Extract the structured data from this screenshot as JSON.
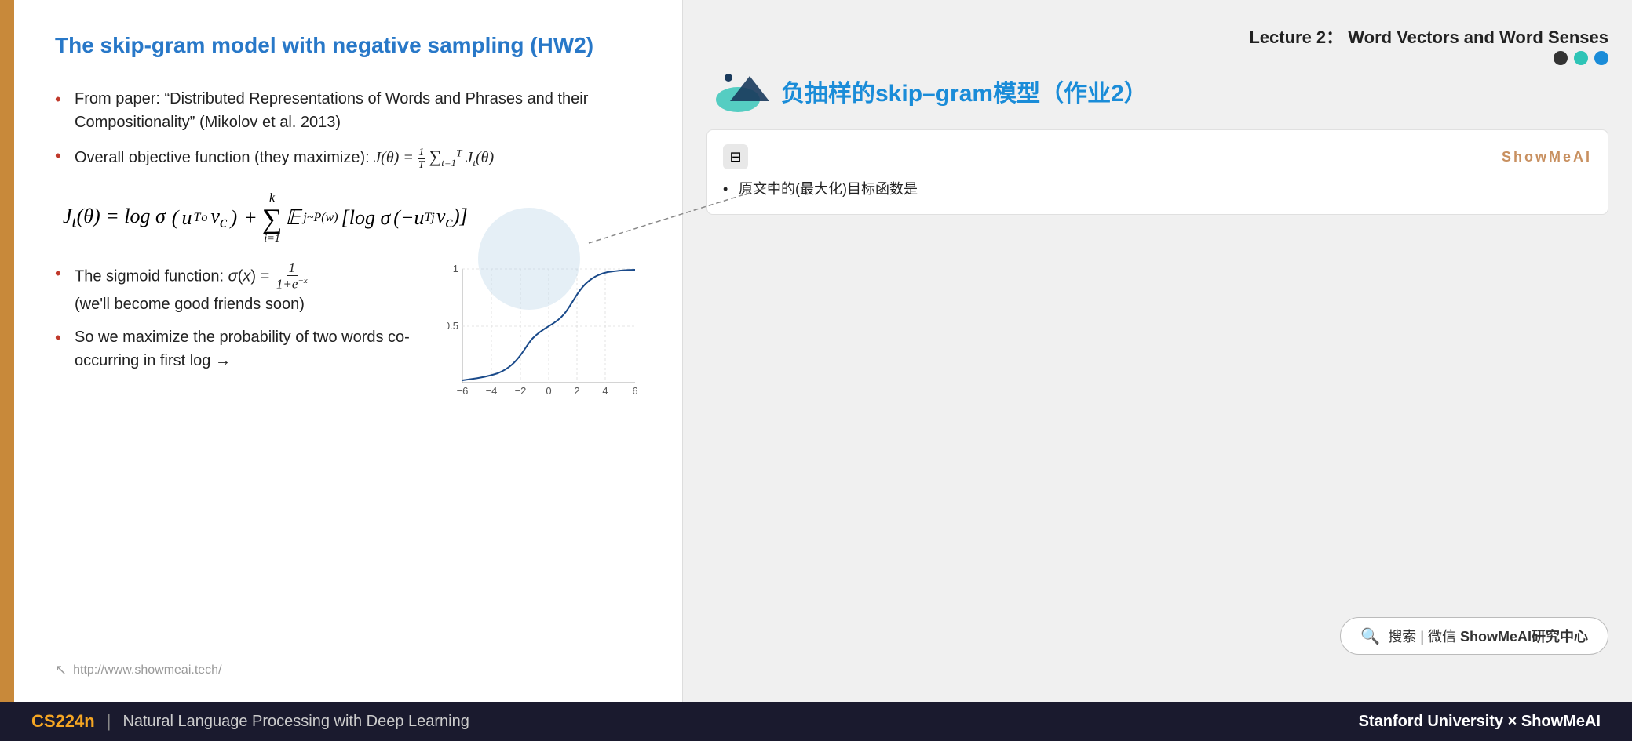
{
  "slide": {
    "left_bar_color": "#c8893a",
    "title": "The skip-gram model with negative sampling (HW2)",
    "bullets": [
      "From paper: “Distributed Representations of Words and Phrases and their Compositionality” (Mikolov et al. 2013)",
      "Overall objective function (they maximize):"
    ],
    "formula_objective": "J(θ) = ½ Σᵗₜ₌₁ Jₜ(θ)",
    "formula_jt": "Jₜ(θ) = log σ (uᵒᵀ vᲜ) + Σᵏᵢ∼P(w) [log σ (−uⱼᵀ vᲜ)]",
    "bottom_bullets": [
      "The sigmoid function: σ(x) = 1/(1+e^⁻ˣ) (we'll become good friends soon)",
      "So we maximize the probability of two words co-occurring in first log →"
    ],
    "url": "http://www.showmeai.tech/"
  },
  "right_panel": {
    "lecture_title": "Lecture 2：  Word Vectors and Word Senses",
    "topic_title_cn": "负抽样的skip–gram模型（作业2）",
    "note": {
      "brand": "ShowMeAI",
      "content": "原文中的(最大化)目标函数是"
    }
  },
  "search_bar": {
    "icon": "🔍",
    "text": "搜索｜微信 ShowMeAI研究中心"
  },
  "footer": {
    "course": "CS224n",
    "divider": "|",
    "description": "Natural Language Processing with Deep Learning",
    "right_text": "Stanford University",
    "right_brand": "× ShowMeAI"
  }
}
